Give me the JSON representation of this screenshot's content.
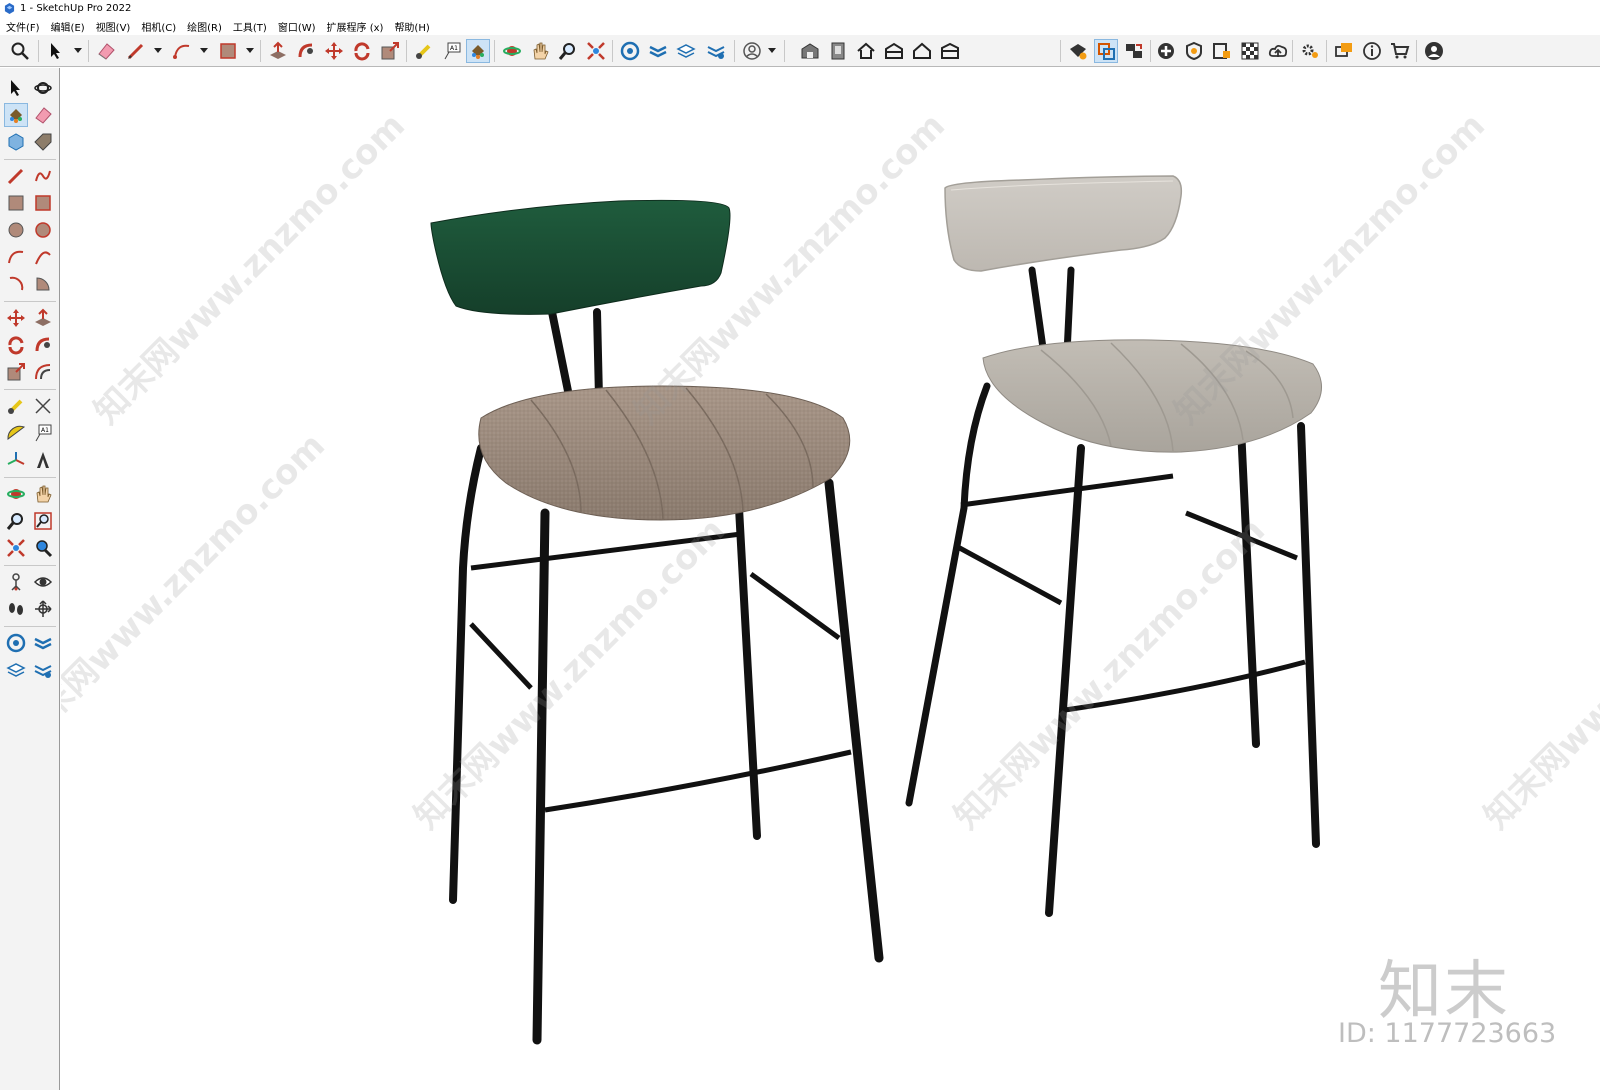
{
  "window": {
    "title": "1 - SketchUp Pro 2022"
  },
  "menu": [
    "文件(F)",
    "编辑(E)",
    "视图(V)",
    "相机(C)",
    "绘图(R)",
    "工具(T)",
    "窗口(W)",
    "扩展程序 (x)",
    "帮助(H)"
  ],
  "toolbar": {
    "icons": [
      "search-icon",
      "select-icon",
      "eraser-icon",
      "pencil-icon",
      "arc-icon",
      "rectangle-icon",
      "push-pull-icon",
      "follow-me-icon",
      "move-icon",
      "rotate-icon",
      "scale-icon",
      "tape-measure-icon",
      "text-icon",
      "paint-bucket-icon",
      "orbit-icon",
      "pan-icon",
      "zoom-icon",
      "zoom-extents-icon",
      "trimble-icon",
      "sandbox-icon",
      "layers-icon",
      "tags-icon",
      "account-icon",
      "warehouse-icon",
      "component-icon",
      "home-icon",
      "house-icon",
      "house-outline-icon",
      "box-icon",
      "ruby-icon",
      "section-icon",
      "scenes-icon",
      "add-location-icon",
      "shield-icon",
      "materials-icon",
      "styles-icon",
      "cloud-icon",
      "settings-icon",
      "chat-icon",
      "info-icon",
      "cart-icon",
      "user-icon"
    ],
    "active": "paint-bucket-icon"
  },
  "left_toolbar": {
    "icons": [
      "select-icon",
      "orbit-icon",
      "paint-bucket-icon",
      "eraser-icon",
      "component-icon",
      "tag-icon",
      "pencil-icon",
      "freehand-icon",
      "rectangle-icon",
      "rotated-rectangle-icon",
      "circle-icon",
      "polygon-icon",
      "arc-icon",
      "two-point-arc-icon",
      "pie-icon",
      "three-point-arc-icon",
      "move-icon",
      "push-pull-icon",
      "rotate-icon",
      "follow-me-icon",
      "scale-icon",
      "offset-icon",
      "tape-measure-icon",
      "dimension-icon",
      "protractor-icon",
      "text-icon",
      "axes-icon",
      "3d-text-icon",
      "orbit-icon",
      "pan-icon",
      "zoom-icon",
      "zoom-window-icon",
      "zoom-extents-icon",
      "previous-view-icon",
      "position-camera-icon",
      "look-around-icon",
      "walk-icon",
      "section-plane-icon",
      "layers-icon",
      "tags-icon",
      "outliner-icon",
      "settings-icon"
    ],
    "active": "paint-bucket-icon"
  },
  "watermark": {
    "repeat_text": "知末网www.znzmo.com",
    "logo_text": "知末",
    "id_text": "ID: 1177723663"
  },
  "scene": {
    "objects": [
      {
        "name": "bar-stool-green",
        "backrest_color": "#1a4d33",
        "seat_color": "#9a8a7c",
        "frame_color": "#111111"
      },
      {
        "name": "bar-stool-beige",
        "backrest_color": "#c9c5bf",
        "seat_color": "#b8b3ab",
        "frame_color": "#111111"
      }
    ]
  },
  "colors": {
    "toolbar_bg": "#f3f3f3",
    "viewport_bg": "#ffffff",
    "active_bg": "#cde3f6"
  }
}
